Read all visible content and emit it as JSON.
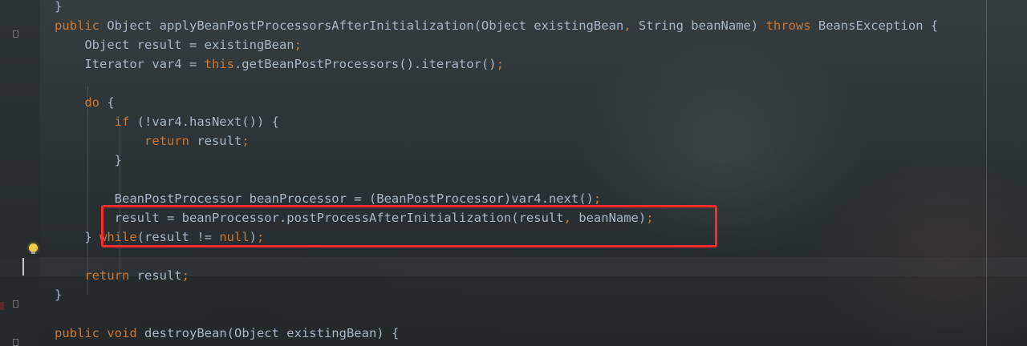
{
  "editor": {
    "lines": [
      {
        "tokens": [
          {
            "t": "}",
            "c": "plain"
          }
        ]
      },
      {
        "tokens": [
          {
            "t": "public",
            "c": "kw"
          },
          {
            "t": " Object ",
            "c": "plain"
          },
          {
            "t": "applyBeanPostProcessorsAfterInitialization",
            "c": "plain"
          },
          {
            "t": "(Object existingBean",
            "c": "plain"
          },
          {
            "t": ",",
            "c": "kw"
          },
          {
            "t": " String beanName) ",
            "c": "plain"
          },
          {
            "t": "throws",
            "c": "kw"
          },
          {
            "t": " BeansException {",
            "c": "plain"
          }
        ]
      },
      {
        "tokens": [
          {
            "t": "    Object result = existingBean",
            "c": "plain"
          },
          {
            "t": ";",
            "c": "kw"
          }
        ]
      },
      {
        "tokens": [
          {
            "t": "    Iterator var4 = ",
            "c": "plain"
          },
          {
            "t": "this",
            "c": "kw"
          },
          {
            "t": ".getBeanPostProcessors().iterator()",
            "c": "plain"
          },
          {
            "t": ";",
            "c": "kw"
          }
        ]
      },
      {
        "tokens": [
          {
            "t": "",
            "c": "plain"
          }
        ]
      },
      {
        "tokens": [
          {
            "t": "    ",
            "c": "plain"
          },
          {
            "t": "do",
            "c": "kw"
          },
          {
            "t": " {",
            "c": "plain"
          }
        ]
      },
      {
        "tokens": [
          {
            "t": "        ",
            "c": "plain"
          },
          {
            "t": "if",
            "c": "kw"
          },
          {
            "t": " (!var4.hasNext()) {",
            "c": "plain"
          }
        ]
      },
      {
        "tokens": [
          {
            "t": "            ",
            "c": "plain"
          },
          {
            "t": "return",
            "c": "kw"
          },
          {
            "t": " result",
            "c": "plain"
          },
          {
            "t": ";",
            "c": "kw"
          }
        ]
      },
      {
        "tokens": [
          {
            "t": "        }",
            "c": "plain"
          }
        ]
      },
      {
        "tokens": [
          {
            "t": "",
            "c": "plain"
          }
        ]
      },
      {
        "tokens": [
          {
            "t": "        BeanPostProcessor beanProcessor = (BeanPostProcessor)var4.next()",
            "c": "plain"
          },
          {
            "t": ";",
            "c": "kw"
          }
        ]
      },
      {
        "tokens": [
          {
            "t": "        result = beanProcessor.postProcessAfterInitialization(result",
            "c": "plain"
          },
          {
            "t": ",",
            "c": "kw"
          },
          {
            "t": " beanName)",
            "c": "plain"
          },
          {
            "t": ";",
            "c": "kw"
          }
        ]
      },
      {
        "tokens": [
          {
            "t": "    } ",
            "c": "plain"
          },
          {
            "t": "while",
            "c": "kw"
          },
          {
            "t": "(result != ",
            "c": "plain"
          },
          {
            "t": "null",
            "c": "kw"
          },
          {
            "t": ")",
            "c": "plain"
          },
          {
            "t": ";",
            "c": "kw"
          }
        ]
      },
      {
        "tokens": [
          {
            "t": "",
            "c": "plain"
          }
        ]
      },
      {
        "tokens": [
          {
            "t": "    ",
            "c": "plain"
          },
          {
            "t": "return",
            "c": "kw"
          },
          {
            "t": " result",
            "c": "plain"
          },
          {
            "t": ";",
            "c": "kw"
          }
        ]
      },
      {
        "tokens": [
          {
            "t": "}",
            "c": "plain"
          }
        ]
      },
      {
        "tokens": [
          {
            "t": "",
            "c": "plain"
          }
        ]
      },
      {
        "tokens": [
          {
            "t": "public",
            "c": "kw"
          },
          {
            "t": " ",
            "c": "plain"
          },
          {
            "t": "void",
            "c": "kw"
          },
          {
            "t": " destroyBean(Object existingBean) {",
            "c": "plain"
          }
        ]
      }
    ]
  },
  "colors": {
    "keyword": "#cc7832",
    "text": "#a9b7c6",
    "annotation_box": "#ff2a2a",
    "intention_bulb": "#f2c94c"
  },
  "icons": {
    "gutter_fold": "fold-marker-icon",
    "intention": "lightbulb-icon"
  }
}
